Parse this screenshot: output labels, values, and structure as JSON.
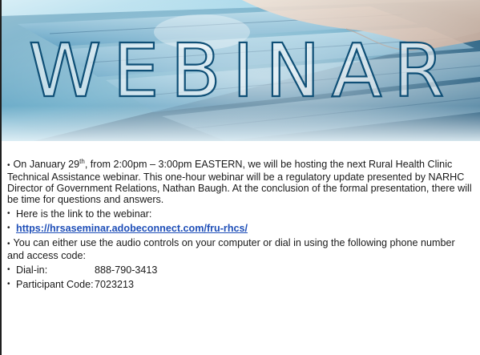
{
  "banner": {
    "word": "WEBINAR",
    "image_description_icon": "laptop-keyboard-photo"
  },
  "content": {
    "p1_prefix": "On January 29",
    "p1_sup": "th",
    "p1_rest": ", from 2:00pm – 3:00pm EASTERN, we will be hosting the next Rural Health Clinic Technical Assistance webinar.  This one-hour webinar will be a regulatory update presented by NARHC Director of Government Relations, Nathan Baugh.  At the conclusion of the formal presentation, there will be time for questions and answers.",
    "link_intro": "Here is the link to the webinar:",
    "link_url": "https://hrsaseminar.adobeconnect.com/fru-rhcs/",
    "audio_text": "You can either use the audio controls on your computer or dial in using the following phone number and access code:",
    "dialin_label": "Dial-in:",
    "dialin_value": "888-790-3413",
    "participant_label": "Participant Code:",
    "participant_value": "7023213",
    "bullet_char": "•"
  },
  "colors": {
    "banner_dark": "#0b3f66",
    "banner_light": "#bfe3f1",
    "link": "#1f4fb8",
    "text": "#1a1a1a"
  }
}
